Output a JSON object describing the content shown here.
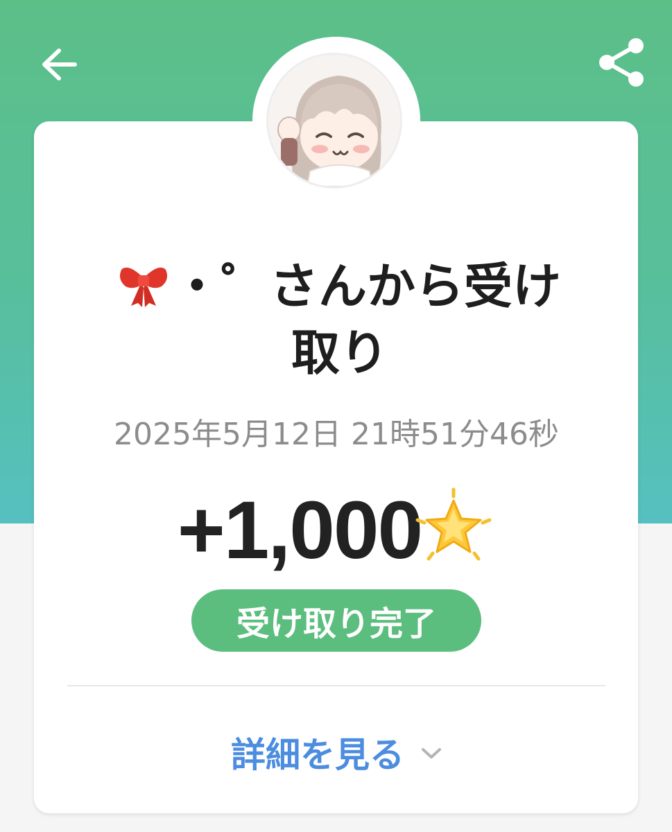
{
  "header": {
    "back_icon": "arrow-left-icon",
    "share_icon": "share-icon",
    "colors": {
      "gradient_top": "#5cbf88",
      "gradient_bottom": "#55c0c0"
    }
  },
  "receipt": {
    "sender_icon": "ribbon-bow-icon",
    "sender_title": "・゜さんから受け取り",
    "timestamp": "2025年5月12日 21時51分46秒",
    "amount": "+1,000",
    "currency_icon": "glowing-star-icon",
    "status": "受け取り完了",
    "status_color": "#5cbe7e"
  },
  "details": {
    "label": "詳細を見る",
    "icon": "chevron-down-icon",
    "color": "#4c8de0"
  }
}
